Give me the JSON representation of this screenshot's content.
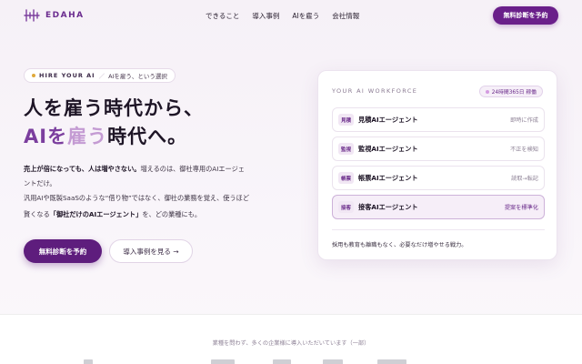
{
  "brand": {
    "name": "EDAHA"
  },
  "nav": {
    "items": [
      "できること",
      "導入事例",
      "AIを雇う",
      "会社情報"
    ],
    "cta": "無料診断を予約"
  },
  "hero": {
    "tag_hire": "HIRE YOUR AI",
    "tag_sep": "／",
    "tag_text": "AIを雇う、という選択",
    "headline_line1": "人を雇う時代から、",
    "headline_ai": "AIを",
    "headline_hire": "雇う",
    "headline_rest": "時代へ。",
    "body_bold1": "売上が倍になっても、人は増やさない。",
    "body_1": "増えるのは、御社専用のAIエージェ",
    "body_2": "ントだけ。",
    "body_3": "汎用AIや既製SaaSのような“借り物”ではなく、御社の業務を覚え、使うほど",
    "body_4_a": "賢くなる",
    "body_4_b": "「御社だけのAIエージェント」",
    "body_4_c": "を、どの業種にも。",
    "btn_primary": "無料診断を予約",
    "btn_secondary": "導入事例を見る →"
  },
  "card": {
    "title": "YOUR AI WORKFORCE",
    "badge": "24時間365日 稼働",
    "agents": [
      {
        "tag": "見積",
        "name": "見積AIエージェント",
        "status": "即時に作成"
      },
      {
        "tag": "監視",
        "name": "監視AIエージェント",
        "status": "不正を検知"
      },
      {
        "tag": "帳票",
        "name": "帳票AIエージェント",
        "status": "読取→転記"
      },
      {
        "tag": "接客",
        "name": "接客AIエージェント",
        "status": "提案を標準化"
      }
    ],
    "footer": "採用も教育も離職もなく、必要なだけ増やせる戦力。"
  },
  "clients": {
    "caption": "業種を問わず、多くの企業様に導入いただいています（一部）"
  },
  "colors": {
    "accent": "#6a1f8a",
    "accent_soft": "#c49bd3",
    "background": "#f6f1f7"
  }
}
